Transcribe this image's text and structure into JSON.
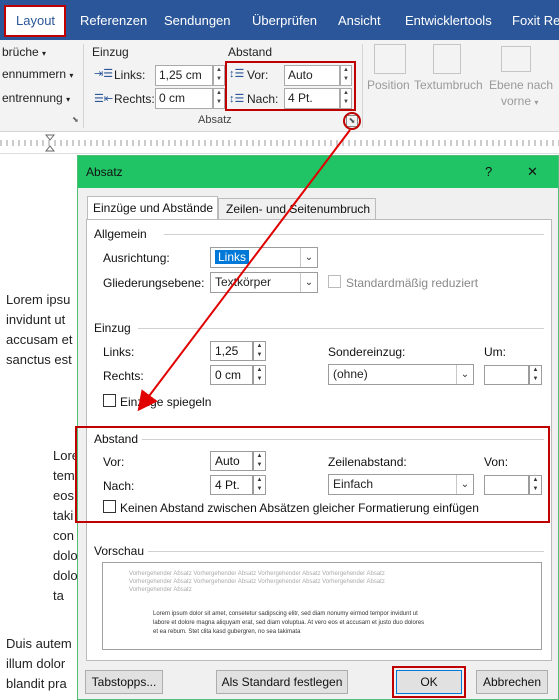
{
  "tabs": {
    "layout": "Layout",
    "referenzen": "Referenzen",
    "sendungen": "Sendungen",
    "ueberpruefen": "Überprüfen",
    "ansicht": "Ansicht",
    "entwicklertools": "Entwicklertools",
    "foxit": "Foxit Rea"
  },
  "ribbon": {
    "col0": [
      "brüche",
      "ennummern",
      "entrennung"
    ],
    "einzug_label": "Einzug",
    "links_label": "Links:",
    "links_value": "1,25 cm",
    "rechts_label": "Rechts:",
    "rechts_value": "0 cm",
    "abstand_label": "Abstand",
    "vor_label": "Vor:",
    "vor_value": "Auto",
    "nach_label": "Nach:",
    "nach_value": "4 Pt.",
    "absatz_group": "Absatz",
    "position": "Position",
    "textumbruch": "Textumbruch",
    "ebene_nach_vorne_1": "Ebene nach",
    "ebene_nach_vorne_2": "vorne"
  },
  "document": {
    "para1": [
      "Lorem ipsu",
      "invidunt ut",
      "accusam et",
      "sanctus est"
    ],
    "para2": [
      "Lore",
      "tem",
      "eos",
      "taki",
      "con",
      "dolo",
      "dolo",
      "ta"
    ],
    "para3": [
      "Duis autem",
      "illum dolor",
      "blandit pra"
    ]
  },
  "dialog": {
    "title": "Absatz",
    "help": "?",
    "close": "✕",
    "tab1": "Einzüge und Abstände",
    "tab2": "Zeilen- und Seitenumbruch",
    "allgemein": "Allgemein",
    "ausrichtung_label": "Ausrichtung:",
    "ausrichtung_value": "Links",
    "gliederung_label": "Gliederungsebene:",
    "gliederung_value": "Textkörper",
    "standard_reduziert": "Standardmäßig reduziert",
    "einzug": "Einzug",
    "links_label": "Links:",
    "links_value": "1,25 cm",
    "rechts_label": "Rechts:",
    "rechts_value": "0 cm",
    "sondereinzug_label": "Sondereinzug:",
    "sondereinzug_value": "(ohne)",
    "um_label": "Um:",
    "spiegeln": "Einzüge spiegeln",
    "abstand": "Abstand",
    "vor_label": "Vor:",
    "vor_value": "Auto",
    "nach_label": "Nach:",
    "nach_value": "4 Pt.",
    "zeilenabstand_label": "Zeilenabstand:",
    "zeilenabstand_value": "Einfach",
    "von_label": "Von:",
    "kein_abstand": "Keinen Abstand zwischen Absätzen gleicher Formatierung einfügen",
    "vorschau": "Vorschau",
    "preview_prev": [
      "Vorhergehender Absatz Vorhergehender Absatz Vorhergehender Absatz Vorhergehender Absatz",
      "Vorhergehender Absatz Vorhergehender Absatz Vorhergehender Absatz Vorhergehender Absatz",
      "Vorhergehender Absatz"
    ],
    "preview_cur": [
      "Lorem ipsum dolor sit amet, consetetur sadipscing elitr, sed diam nonumy eirmod tempor invidunt ut",
      "labore et dolore magna aliquyam erat, sed diam voluptua. At vero eos et accusam et justo duo dolores",
      "et ea rebum. Stet clita kasd gubergren, no sea takimata"
    ],
    "tabstopps": "Tabstopps...",
    "als_standard": "Als Standard festlegen",
    "ok": "OK",
    "abbrechen": "Abbrechen"
  },
  "colors": {
    "tabbar": "#2b579a",
    "dialog_title": "#21c465",
    "highlight": "#c00000",
    "arrow": "#e00000"
  }
}
